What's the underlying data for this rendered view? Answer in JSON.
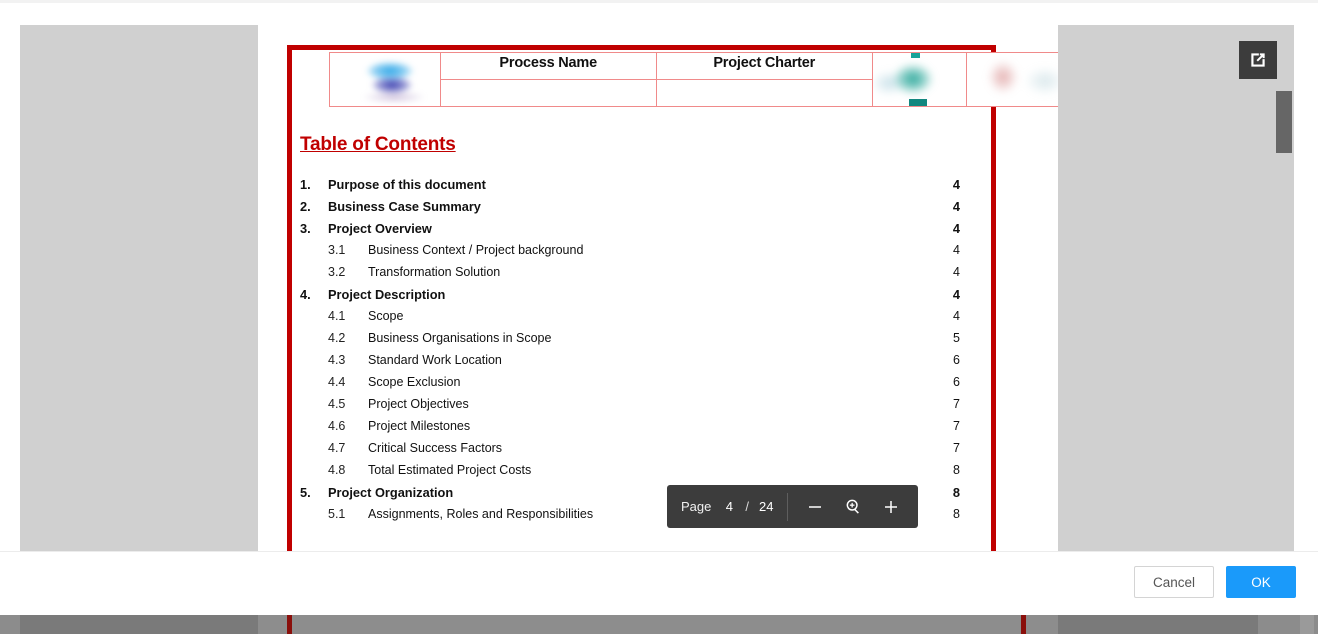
{
  "dialog": {
    "footer": {
      "cancel_label": "Cancel",
      "ok_label": "OK"
    },
    "popout": {
      "icon": "external-link-icon"
    }
  },
  "pdf_toolbar": {
    "page_label": "Page",
    "current_page": "4",
    "separator": "/",
    "total_pages": "24",
    "zoom_out_icon": "minus-icon",
    "zoom_level_icon": "magnifier-plus-icon",
    "zoom_in_icon": "plus-icon"
  },
  "document": {
    "header_table": {
      "logo_alt": "company-logo",
      "columns": [
        {
          "label": "Process Name",
          "value": ""
        },
        {
          "label": "Project Charter",
          "value": ""
        }
      ],
      "trailing_images": [
        "decorative-image-left",
        "decorative-image-right"
      ]
    },
    "toc_title": "Table of Contents",
    "toc_entries": [
      {
        "level": 1,
        "num": "1.",
        "title": "Purpose of this document",
        "page": "4"
      },
      {
        "level": 1,
        "num": "2.",
        "title": "Business Case Summary",
        "page": "4"
      },
      {
        "level": 1,
        "num": "3.",
        "title": "Project Overview",
        "page": "4"
      },
      {
        "level": 2,
        "num": "3.1",
        "title": "Business Context / Project background",
        "page": "4"
      },
      {
        "level": 2,
        "num": "3.2",
        "title": "Transformation Solution",
        "page": "4"
      },
      {
        "level": 1,
        "num": "4.",
        "title": "Project Description",
        "page": "4"
      },
      {
        "level": 2,
        "num": "4.1",
        "title": "Scope",
        "page": "4"
      },
      {
        "level": 2,
        "num": "4.2",
        "title": "Business Organisations in Scope",
        "page": "5"
      },
      {
        "level": 2,
        "num": "4.3",
        "title": "Standard Work Location",
        "page": "6"
      },
      {
        "level": 2,
        "num": "4.4",
        "title": "Scope Exclusion",
        "page": "6"
      },
      {
        "level": 2,
        "num": "4.5",
        "title": "Project Objectives",
        "page": "7"
      },
      {
        "level": 2,
        "num": "4.6",
        "title": "Project Milestones",
        "page": "7"
      },
      {
        "level": 2,
        "num": "4.7",
        "title": "Critical Success Factors",
        "page": "7"
      },
      {
        "level": 2,
        "num": "4.8",
        "title": "Total Estimated Project Costs",
        "page": "8"
      },
      {
        "level": 1,
        "num": "5.",
        "title": "Project Organization",
        "page": "8"
      },
      {
        "level": 2,
        "num": "5.1",
        "title": "Assignments, Roles and Responsibilities",
        "page": "8"
      }
    ]
  },
  "colors": {
    "accent_red": "#c00000",
    "toolbar_bg": "#3c3c3c",
    "ok_blue": "#1a9afa",
    "canvas_gray": "#d0d0d0",
    "scrollbar_thumb": "#666666"
  }
}
